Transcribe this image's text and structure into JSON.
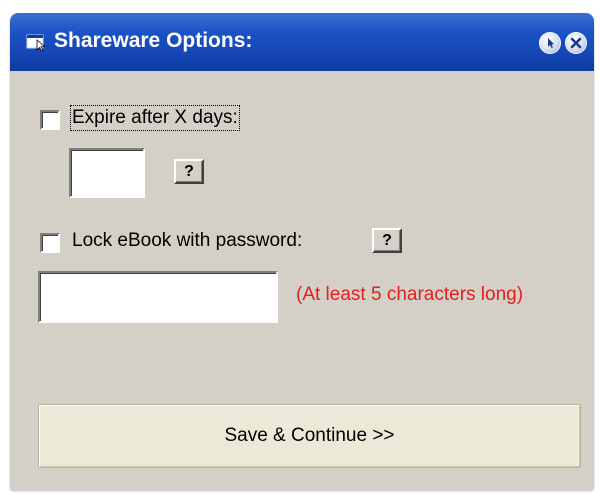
{
  "window": {
    "title": "Shareware Options:",
    "title_bar_color": "#1a52c4",
    "help_button_icon": "help-icon",
    "close_button_icon": "close-icon",
    "app_icon": "app-window-icon"
  },
  "expire": {
    "label": "Expire after X days:",
    "checked": false,
    "days_value": "",
    "help_label": "?"
  },
  "password": {
    "label": "Lock eBook with password:",
    "checked": false,
    "value": "",
    "help_label": "?",
    "hint": "(At least 5 characters long)",
    "hint_color": "#e02020"
  },
  "actions": {
    "save_label": "Save & Continue >>"
  }
}
